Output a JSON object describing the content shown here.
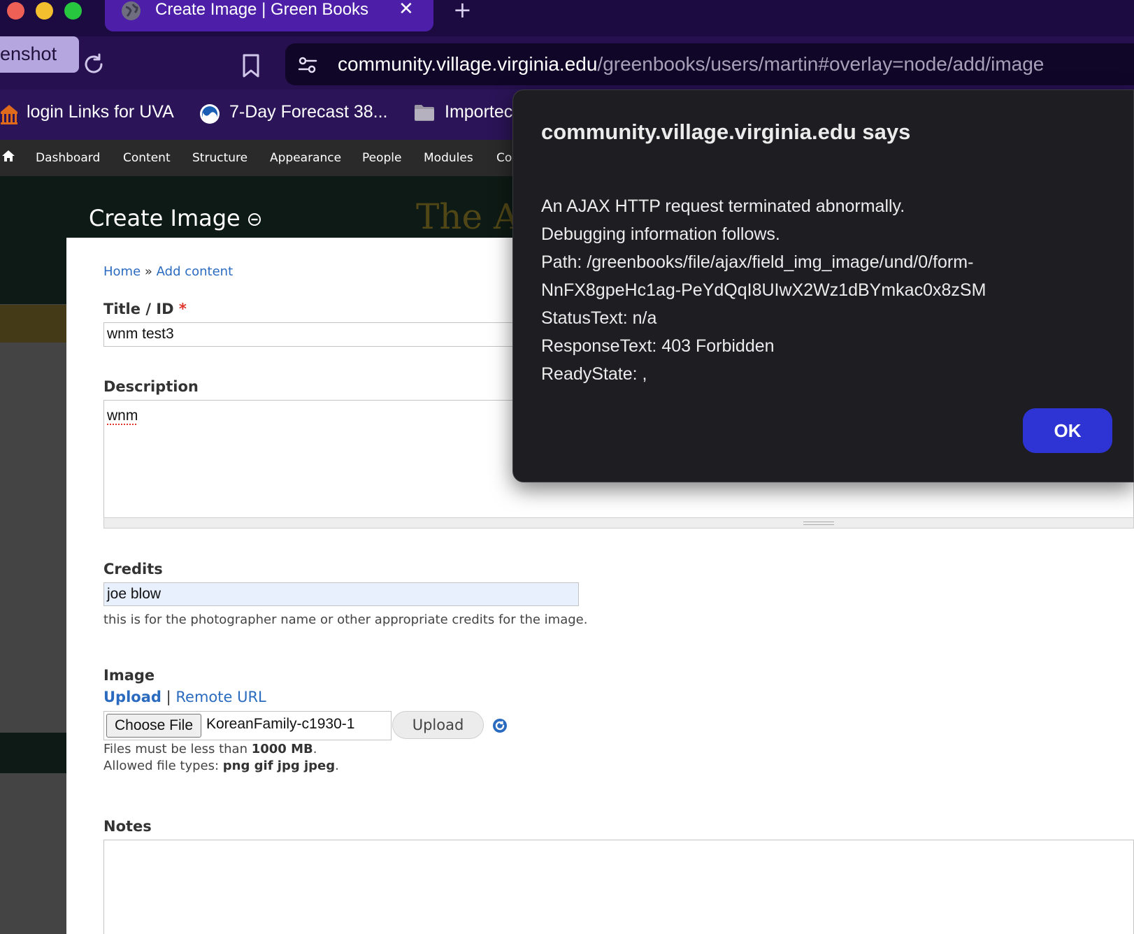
{
  "browser": {
    "tab": {
      "title": "Create Image | Green Books",
      "close_glyph": "✕"
    },
    "new_tab_glyph": "+",
    "screenshot_chip": "enshot",
    "url": {
      "host": "community.village.virginia.edu",
      "path": "/greenbooks/users/martin#overlay=node/add/image"
    },
    "bookmarks": [
      {
        "label": "login Links for UVA",
        "icon": "rotunda-icon"
      },
      {
        "label": "7-Day Forecast 38...",
        "icon": "noaa-icon"
      },
      {
        "label": "Importec",
        "icon": "folder-icon"
      }
    ]
  },
  "admin_menu": {
    "items": [
      "Dashboard",
      "Content",
      "Structure",
      "Appearance",
      "People",
      "Modules",
      "Co"
    ]
  },
  "overlay": {
    "title": "Create Image",
    "background_title": "The Ar"
  },
  "form": {
    "breadcrumb": {
      "home": "Home",
      "separator": "»",
      "add_content": "Add content"
    },
    "title_field": {
      "label": "Title / ID",
      "required_mark": "*",
      "value": "wnm test3"
    },
    "description": {
      "label": "Description",
      "value": "wnm"
    },
    "credits": {
      "label": "Credits",
      "value": "joe blow",
      "help": "this is for the photographer name or other appropriate credits for the image."
    },
    "image": {
      "label": "Image",
      "upload_link": "Upload",
      "separator": "|",
      "remote_link": "Remote URL",
      "choose_file": "Choose File",
      "file_name": "KoreanFamily-c1930-1",
      "upload_button": "Upload",
      "help_size_prefix": "Files must be less than",
      "help_size_value": "1000 MB",
      "help_size_suffix": ".",
      "help_types_prefix": "Allowed file types:",
      "help_types_value": "png gif jpg jpeg",
      "help_types_suffix": "."
    },
    "notes": {
      "label": "Notes"
    }
  },
  "dialog": {
    "title": "community.village.virginia.edu says",
    "lines": [
      "An AJAX HTTP request terminated abnormally.",
      "Debugging information follows.",
      "Path: /greenbooks/file/ajax/field_img_image/und/0/form-",
      "NnFX8gpeHc1ag-PeYdQqI8UIwX2Wz1dBYmkac0x8zSM",
      "StatusText: n/a",
      "ResponseText: 403 Forbidden",
      "ReadyState: ,"
    ],
    "ok_label": "OK"
  },
  "colors": {
    "tab_active": "#4d1fa8",
    "link": "#2a6bbf",
    "ok_button": "#2e34d4",
    "credits_autofill": "#e8f0fe"
  }
}
